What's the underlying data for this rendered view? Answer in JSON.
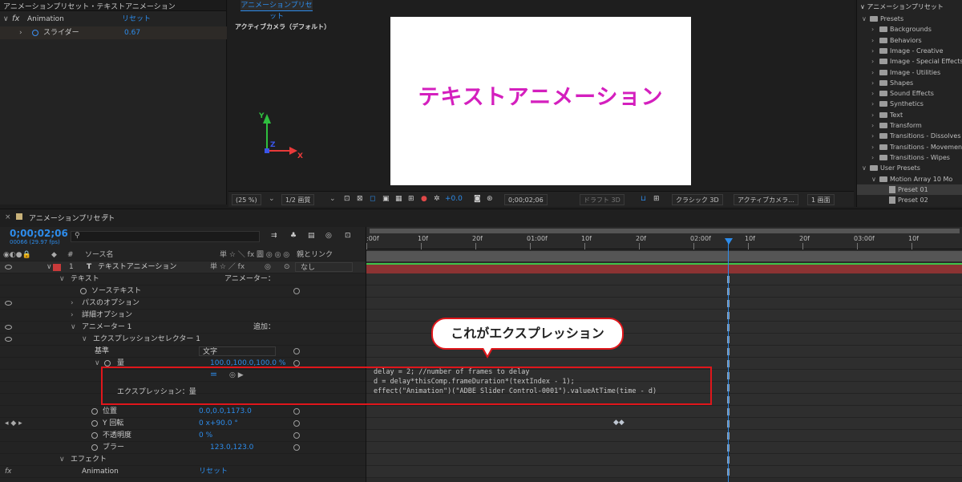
{
  "effects": {
    "tab_title": "アニメーションプリセット・テキストアニメーション",
    "fx_label": "fx",
    "effect_name": "Animation",
    "reset_label": "リセット",
    "param_name": "スライダー",
    "param_value": "0.67"
  },
  "comp": {
    "tab": "アニメーションプリセット",
    "camera_label": "アクティブカメラ（デフォルト）",
    "canvas_text": "テキストアニメーション",
    "axis_y": "Y",
    "axis_z": "Z",
    "axis_x": "X",
    "toolbar": {
      "zoom": "(25 %)",
      "resolution": "1/2 画質",
      "exposure": "+0.0",
      "timecode": "0;00;02;06",
      "draft3d": "ドラフト 3D",
      "renderer": "クラシック 3D",
      "camera": "アクティブカメラ...",
      "views": "1 画面"
    }
  },
  "project": {
    "title": "アニメーションプリセット",
    "items": [
      {
        "label": "Presets",
        "kind": "folder",
        "indent": 1,
        "open": true
      },
      {
        "label": "Backgrounds",
        "kind": "folder",
        "indent": 2
      },
      {
        "label": "Behaviors",
        "kind": "folder",
        "indent": 2
      },
      {
        "label": "Image - Creative",
        "kind": "folder",
        "indent": 2
      },
      {
        "label": "Image - Special Effects",
        "kind": "folder",
        "indent": 2
      },
      {
        "label": "Image - Utilities",
        "kind": "folder",
        "indent": 2
      },
      {
        "label": "Shapes",
        "kind": "folder",
        "indent": 2
      },
      {
        "label": "Sound Effects",
        "kind": "folder",
        "indent": 2
      },
      {
        "label": "Synthetics",
        "kind": "folder",
        "indent": 2
      },
      {
        "label": "Text",
        "kind": "folder",
        "indent": 2
      },
      {
        "label": "Transform",
        "kind": "folder",
        "indent": 2
      },
      {
        "label": "Transitions - Dissolves",
        "kind": "folder",
        "indent": 2
      },
      {
        "label": "Transitions - Movement",
        "kind": "folder",
        "indent": 2
      },
      {
        "label": "Transitions - Wipes",
        "kind": "folder",
        "indent": 2
      },
      {
        "label": "User Presets",
        "kind": "folder",
        "indent": 1,
        "open": true
      },
      {
        "label": "Motion Array 10 Mo",
        "kind": "folder",
        "indent": 2,
        "open": true
      },
      {
        "label": "Preset 01",
        "kind": "file",
        "indent": 3,
        "selected": true
      },
      {
        "label": "Preset 02",
        "kind": "file",
        "indent": 3
      }
    ]
  },
  "timeline": {
    "tab": "アニメーションプリセット",
    "timecode": "0;00;02;06",
    "frames": "00066 (29.97 fps)",
    "search_placeholder": "",
    "col_num": "#",
    "col_source": "ソース名",
    "col_switches": "単 ☆ ＼ fx 圖 ◎ ◎ ◎",
    "col_parent": "親とリンク",
    "ruler": [
      ":00f",
      "10f",
      "20f",
      "01:00f",
      "10f",
      "20f",
      "02:00f",
      "10f",
      "20f",
      "03:00f",
      "10f"
    ],
    "layer": {
      "num": "1",
      "name": "テキストアニメーション",
      "parent": "なし",
      "switch_icons": "単 ☆ ／ fx"
    },
    "rows": {
      "text": "テキスト",
      "animator_menu": "アニメーター：",
      "source_text": "ソーステキスト",
      "path_options": "パスのオプション",
      "more_options": "詳細オプション",
      "animator1": "アニメーター 1",
      "add": "追加：",
      "expr_selector": "エクスプレッションセレクター 1",
      "basis": "基準",
      "basis_value": "文字",
      "amount": "量",
      "amount_value": "100.0,100.0,100.0 %",
      "expression_label": "エクスプレッション：量",
      "position": "位置",
      "position_value": "0.0,0.0,1173.0",
      "y_rotation": "Y 回転",
      "y_rotation_value": "0 x+90.0 °",
      "opacity": "不透明度",
      "opacity_value": "0 %",
      "blur": "ブラー",
      "blur_value": "123.0,123.0",
      "effects": "エフェクト",
      "animation": "Animation",
      "reset": "リセット",
      "fx_label": "fx"
    },
    "code": [
      "delay = 2; //number of frames to delay",
      "d = delay*thisComp.frameDuration*(textIndex - 1);",
      "effect(\"Animation\")(\"ADBE Slider Control-0001\").valueAtTime(time - d)"
    ],
    "callout": "これがエクスプレッション"
  }
}
